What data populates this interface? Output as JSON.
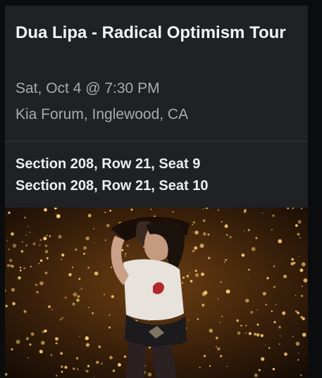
{
  "event": {
    "title": "Dua Lipa - Radical Optimism Tour",
    "date_time": "Sat, Oct 4 @ 7:30 PM",
    "venue": "Kia Forum, Inglewood, CA"
  },
  "seats": [
    "Section 208, Row 21, Seat 9",
    "Section 208, Row 21, Seat 10"
  ],
  "colors": {
    "background": "#0b0c0d",
    "card": "#1f2124",
    "title_text": "#f3f4f5",
    "secondary_text": "#a6abb1",
    "lights": "#ffd98a"
  }
}
